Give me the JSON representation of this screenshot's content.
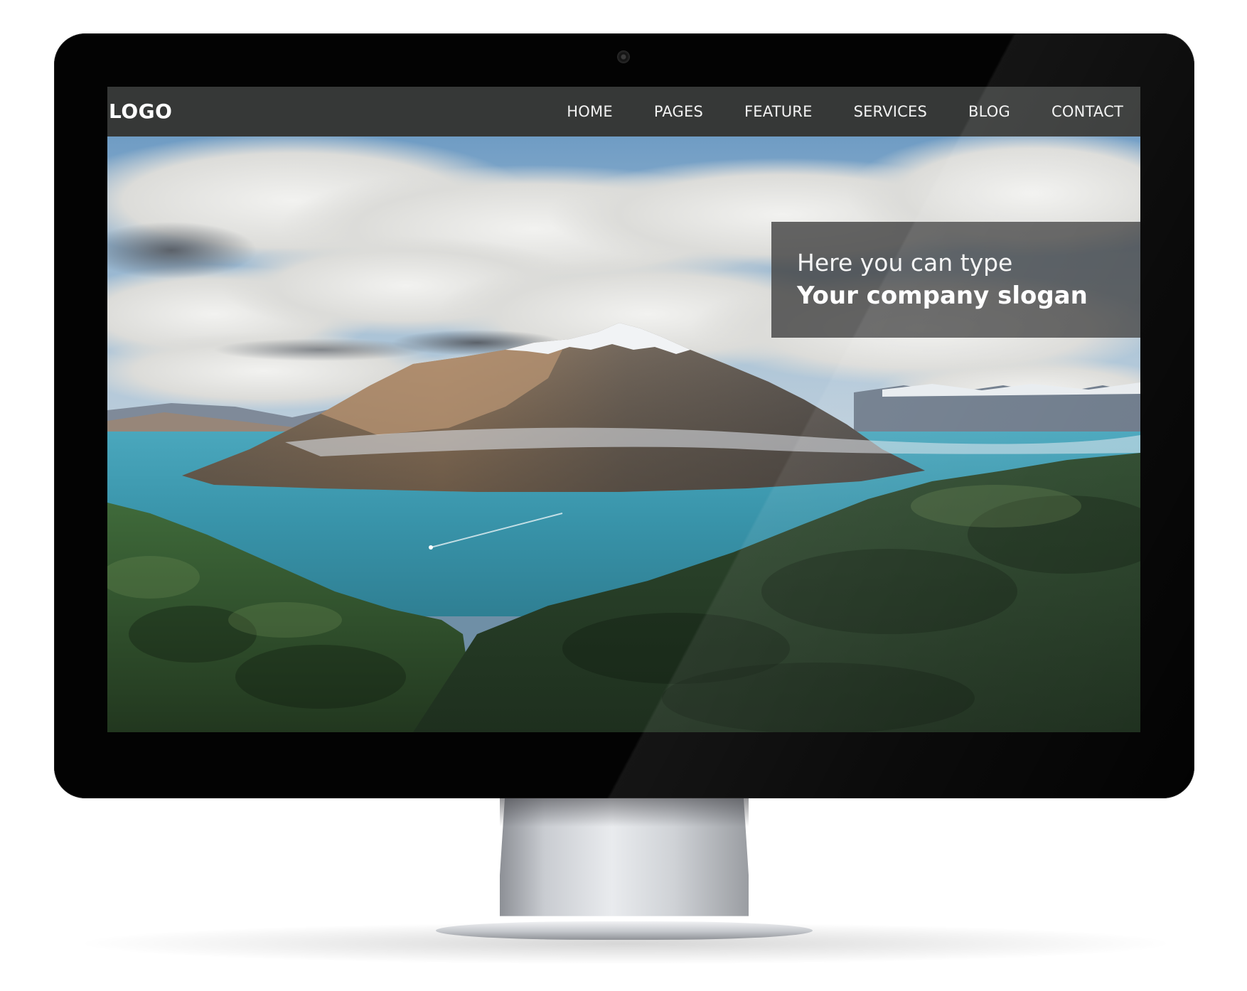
{
  "site": {
    "logo": "LOGO",
    "nav": {
      "items": [
        {
          "label": "HOME"
        },
        {
          "label": "PAGES"
        },
        {
          "label": "FEATURE"
        },
        {
          "label": "SERVICES"
        },
        {
          "label": "BLOG"
        },
        {
          "label": "CONTACT"
        }
      ]
    },
    "hero": {
      "image": "mountain-lake-landscape",
      "slogan_line1": "Here you can type",
      "slogan_line2": "Your company slogan"
    },
    "colors": {
      "nav_bg": "#363837",
      "slogan_bg": "#444444",
      "text": "#ffffff",
      "lake": "#3f9db0",
      "forest": "#2c4a2e"
    }
  },
  "device": {
    "type": "desktop-monitor",
    "camera_icon": "camera-icon"
  }
}
